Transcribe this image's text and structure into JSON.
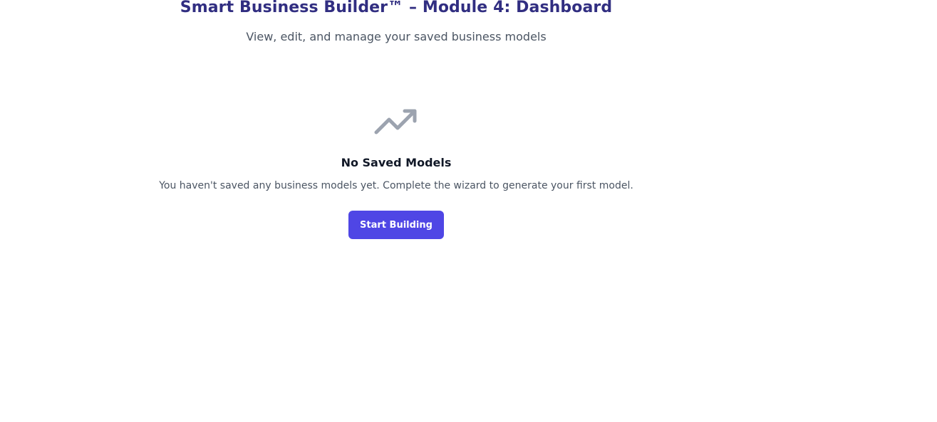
{
  "header": {
    "title": "Smart Business Builder™ – Module 4: Dashboard",
    "subtitle": "View, edit, and manage your saved business models"
  },
  "empty_state": {
    "icon": "trending-up-icon",
    "title": "No Saved Models",
    "message": "You haven't saved any business models yet. Complete the wizard to generate your first model.",
    "button_label": "Start Building"
  },
  "colors": {
    "title": "#312e81",
    "subtitle": "#4b5563",
    "icon": "#9ca3af",
    "button_bg": "#4f46e5",
    "button_text": "#ffffff"
  }
}
